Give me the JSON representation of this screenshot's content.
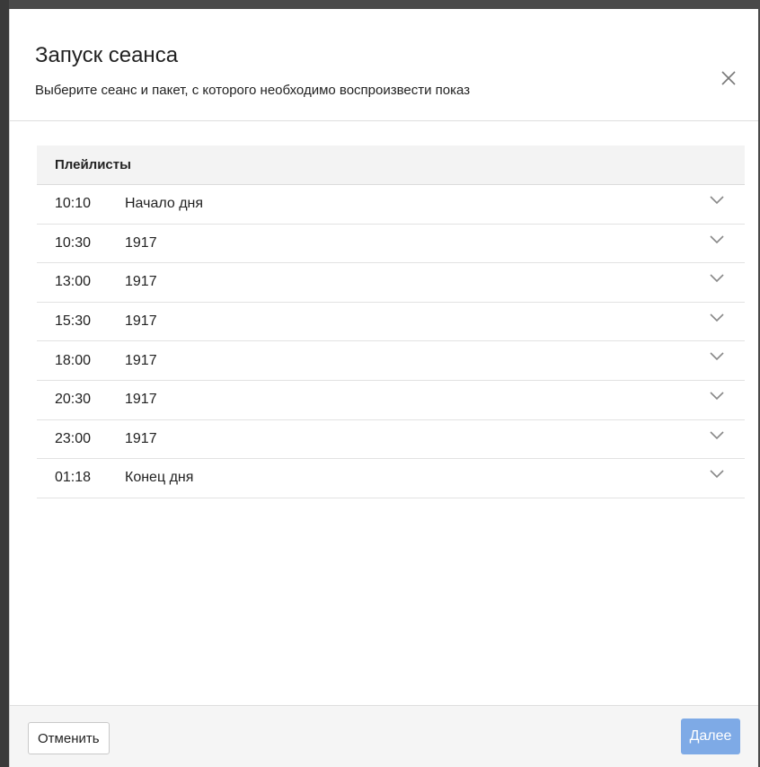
{
  "modal": {
    "title": "Запуск сеанса",
    "subtitle": "Выберите сеанс и пакет, с которого необходимо воспроизвести показ",
    "close_icon": "close-icon"
  },
  "playlist": {
    "header": "Плейлисты",
    "rows": [
      {
        "time": "10:10",
        "name": "Начало дня"
      },
      {
        "time": "10:30",
        "name": "1917"
      },
      {
        "time": "13:00",
        "name": "1917"
      },
      {
        "time": "15:30",
        "name": "1917"
      },
      {
        "time": "18:00",
        "name": "1917"
      },
      {
        "time": "20:30",
        "name": "1917"
      },
      {
        "time": "23:00",
        "name": "1917"
      },
      {
        "time": "01:18",
        "name": "Конец дня"
      }
    ],
    "row_icon": "chevron-down-icon"
  },
  "footer": {
    "cancel_label": "Отменить",
    "next_label": "Далее"
  },
  "colors": {
    "primary_button": "#7eaae6",
    "backdrop": "#4a4a4a"
  }
}
